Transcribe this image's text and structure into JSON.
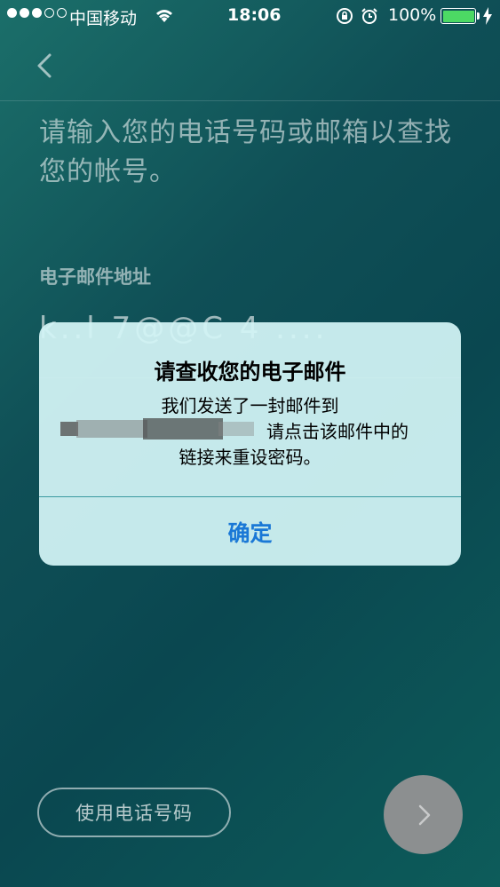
{
  "status_bar": {
    "carrier": "中国移动",
    "time": "18:06",
    "battery_percent": "100%",
    "battery_color": "#4cd964"
  },
  "nav": {
    "back_icon": "chevron-left-icon"
  },
  "form": {
    "prompt": "请输入您的电话号码或邮箱以查找您的帐号。",
    "email_label": "电子邮件地址",
    "email_value": "k..l 7@@C 4 ...."
  },
  "dialog": {
    "title": "请查收您的电子邮件",
    "message_line1": "我们发送了一封邮件到",
    "message_line2": "请点击该邮件中的",
    "message_line3": "链接来重设密码。",
    "ok_label": "确定",
    "ok_color": "#1a78d6"
  },
  "bottom": {
    "use_phone_label": "使用电话号码",
    "next_icon": "chevron-right-icon"
  }
}
